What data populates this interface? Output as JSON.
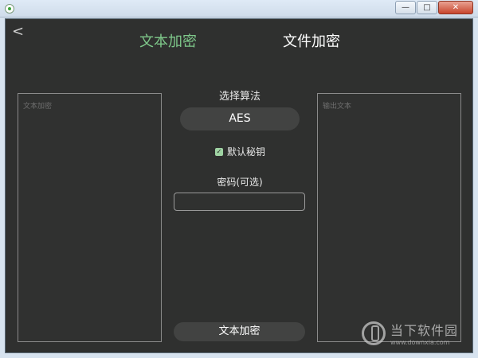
{
  "window": {
    "minimize": "—",
    "maximize": "□",
    "close": "✕"
  },
  "nav": {
    "back_icon": "chevron-left-icon",
    "back_glyph": "<",
    "tabs": [
      {
        "label": "文本加密",
        "active": true
      },
      {
        "label": "文件加密",
        "active": false
      }
    ]
  },
  "input_panel": {
    "placeholder": "文本加密"
  },
  "output_panel": {
    "placeholder": "输出文本"
  },
  "algorithm": {
    "label": "选择算法",
    "value": "AES"
  },
  "default_key": {
    "label": "默认秘钥",
    "checked": true
  },
  "password": {
    "label": "密码(可选)",
    "value": ""
  },
  "action": {
    "label": "文本加密"
  },
  "watermark": {
    "main": "当下软件园",
    "sub": "www.downxia.com"
  },
  "colors": {
    "active_tab": "#7fc98b",
    "background": "#2f302f"
  }
}
